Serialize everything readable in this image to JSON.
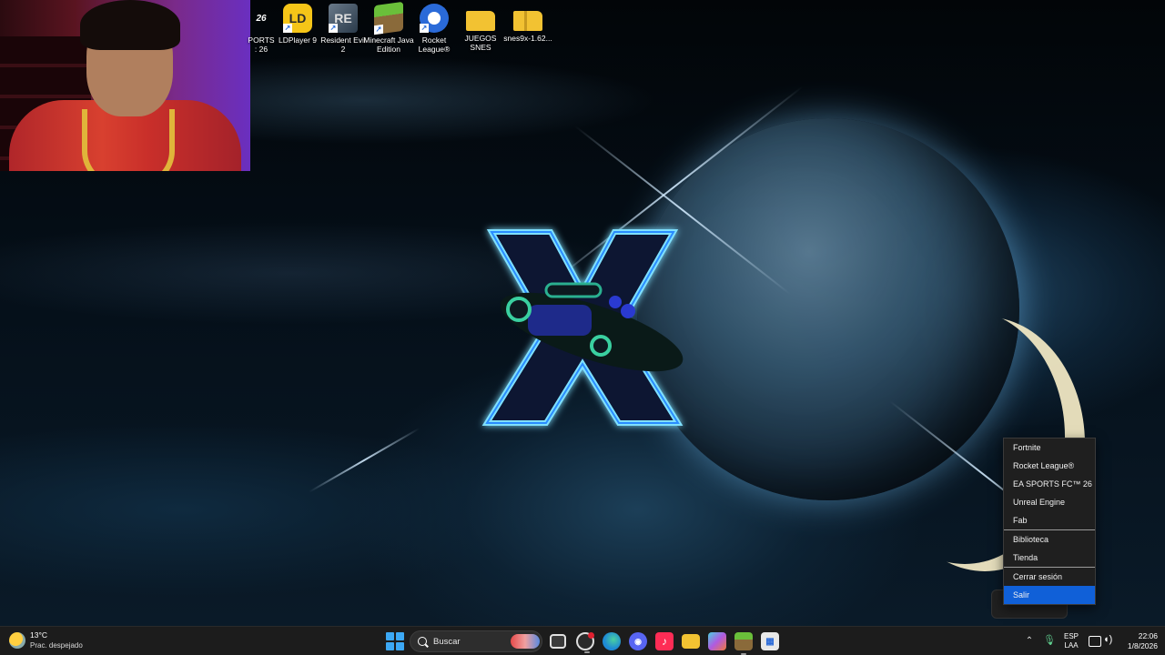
{
  "desktop": {
    "icons": [
      {
        "label": "PORTS : 26",
        "icon": "ea-sports-fc-icon",
        "color": "#1a1a1a",
        "glyph": "26"
      },
      {
        "label": "LDPlayer 9",
        "icon": "ldplayer-icon",
        "color": "#f5c518",
        "glyph": "LD"
      },
      {
        "label": "Resident Evil 2",
        "icon": "resident-evil-icon",
        "color": "#4a5a6a",
        "glyph": "RE"
      },
      {
        "label": "Minecraft Java Edition",
        "icon": "minecraft-icon",
        "color": "#5a9a3a",
        "glyph": "MC"
      },
      {
        "label": "Rocket League®",
        "icon": "rocket-league-icon",
        "color": "#2a6ad8",
        "glyph": "RL"
      },
      {
        "label": "JUEGOS SNES",
        "icon": "folder-icon",
        "color": "#f2c232",
        "glyph": ""
      },
      {
        "label": "snes9x-1.62...",
        "icon": "zip-folder-icon",
        "color": "#f2c232",
        "glyph": ""
      }
    ]
  },
  "context_menu": {
    "items": [
      {
        "label": "Fortnite"
      },
      {
        "label": "Rocket League®"
      },
      {
        "label": "EA SPORTS FC™ 26"
      },
      {
        "label": "Unreal Engine"
      },
      {
        "label": "Fab"
      },
      {
        "label": "Biblioteca"
      },
      {
        "label": "Tienda"
      },
      {
        "label": "Cerrar sesión"
      },
      {
        "label": "Salir"
      }
    ],
    "highlighted": "Salir",
    "highlight_color": "#1060d8"
  },
  "taskbar": {
    "weather": {
      "temp": "13°C",
      "condition": "Prac. despejado",
      "icon": "partly-sunny-icon"
    },
    "search": {
      "placeholder": "Buscar"
    },
    "apps": [
      {
        "name": "task-view",
        "icon": "task-view-icon",
        "color": "#e0e0e0"
      },
      {
        "name": "obs",
        "icon": "obs-icon",
        "color": "#2a2a2a"
      },
      {
        "name": "edge",
        "icon": "edge-icon",
        "color": "#1e8ad6"
      },
      {
        "name": "discord",
        "icon": "discord-icon",
        "color": "#5865f2"
      },
      {
        "name": "tiktok",
        "icon": "tiktok-icon",
        "color": "#fe2c55"
      },
      {
        "name": "file-explorer",
        "icon": "folder-icon",
        "color": "#f2c232"
      },
      {
        "name": "m365",
        "icon": "m365-icon",
        "color": "#b05ae0"
      },
      {
        "name": "minecraft",
        "icon": "minecraft-icon",
        "color": "#5a9a3a"
      },
      {
        "name": "store",
        "icon": "store-icon",
        "color": "#e8e8e8"
      }
    ],
    "tray": {
      "lang_top": "ESP",
      "lang_bottom": "LAA",
      "time": "22:06",
      "date": "1/8/2026"
    }
  }
}
